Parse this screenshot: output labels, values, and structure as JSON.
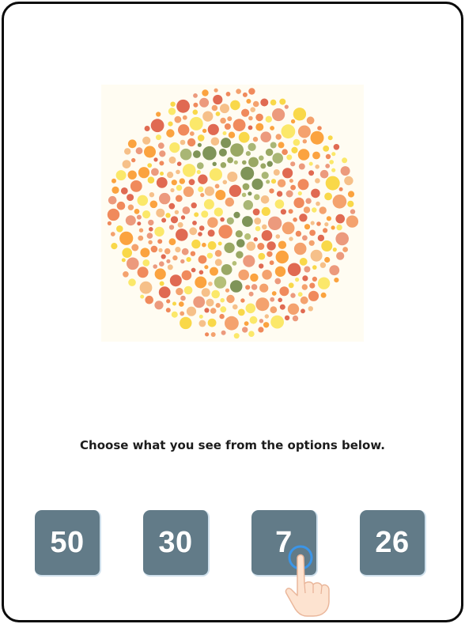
{
  "instruction": "Choose what you see from the options below.",
  "plate": {
    "hidden_figure": "7",
    "colors": {
      "background": [
        "#e06a52",
        "#f4a26e",
        "#f6c089",
        "#f9d849",
        "#fbe86a",
        "#f08a5c",
        "#ec9a7d",
        "#fba33f"
      ],
      "figure": [
        "#9aa864",
        "#b5bf77",
        "#7f9458",
        "#a9b675"
      ]
    }
  },
  "options": [
    {
      "label": "50"
    },
    {
      "label": "30"
    },
    {
      "label": "7"
    },
    {
      "label": "26"
    }
  ],
  "colors": {
    "option_bg": "#627b88",
    "frame_border": "#0b0b0b",
    "tap_ring": "#3b95e8"
  },
  "icons": {
    "pointer": "tap-hand-icon"
  }
}
